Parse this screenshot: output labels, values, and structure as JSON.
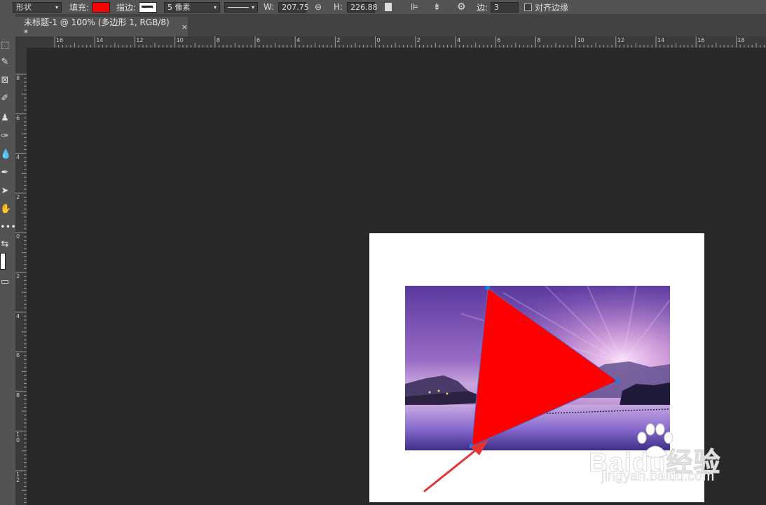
{
  "options_bar": {
    "mode_value": "形状",
    "fill_label": "填充:",
    "fill_color": "#ff0000",
    "stroke_label": "描边:",
    "stroke_width_value": "5 像素",
    "w_label": "W:",
    "w_value": "207.75",
    "h_label": "H:",
    "h_value": "226.88",
    "sides_label": "边:",
    "sides_value": "3",
    "align_edges_label": "对齐边缘"
  },
  "document_tab": {
    "title": "未标题-1 @ 100% (多边形 1, RGB/8) *",
    "close_glyph": "×"
  },
  "ruler": {
    "horizontal_labels": [
      "16",
      "14",
      "12",
      "10",
      "8",
      "6",
      "4",
      "2",
      "0",
      "2",
      "4",
      "6",
      "8",
      "10",
      "12",
      "14",
      "16",
      "18"
    ],
    "vertical_labels": [
      "8",
      "6",
      "4",
      "2",
      "0",
      "2",
      "4",
      "6",
      "8",
      "10",
      "12"
    ]
  },
  "watermark": {
    "main_text": "Baidu经验",
    "url_text": "jingyan.baidu.com"
  },
  "colors": {
    "triangle": "#ff0000",
    "arrow": "#e53333",
    "handle": "#1a7de0"
  }
}
